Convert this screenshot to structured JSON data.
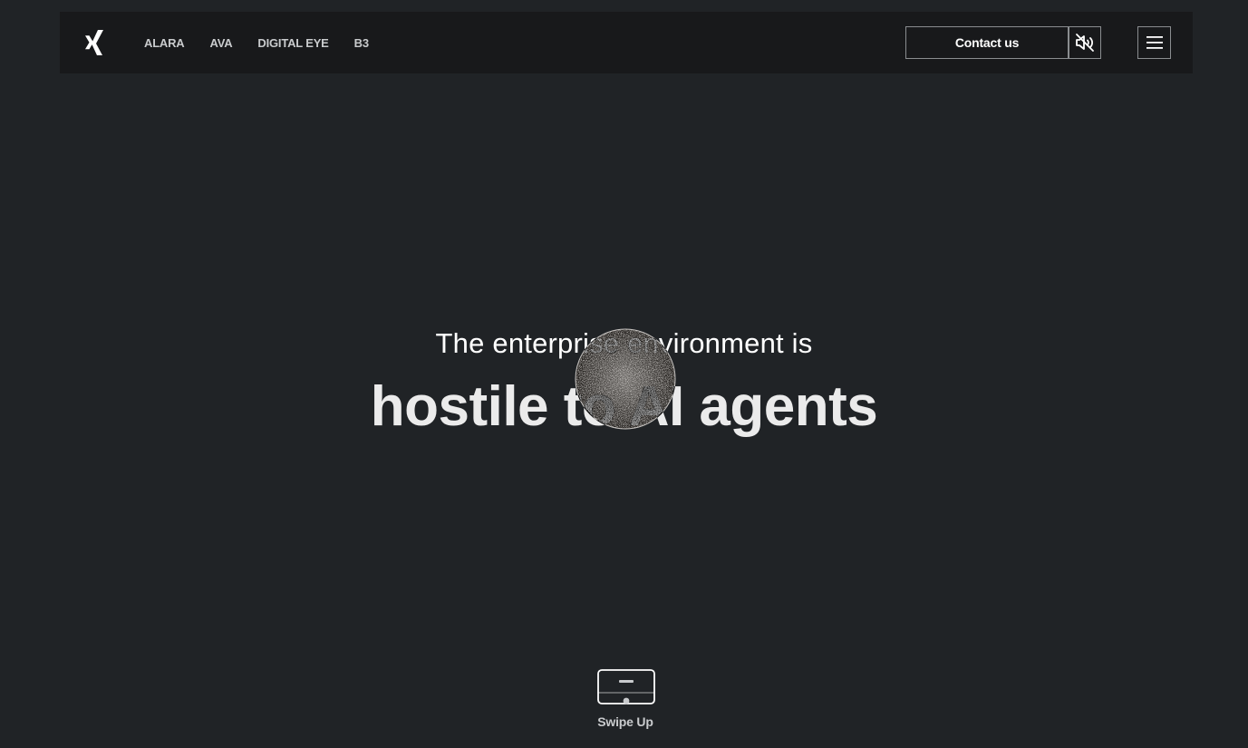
{
  "header": {
    "logo_icon": "x-brand-logo-icon",
    "nav": [
      {
        "label": "ALARA"
      },
      {
        "label": "AVA"
      },
      {
        "label": "DIGITAL EYE"
      },
      {
        "label": "B3"
      }
    ],
    "contact_label": "Contact us",
    "mute_icon": "speaker-muted-icon",
    "menu_icon": "hamburger-menu-icon"
  },
  "hero": {
    "subtitle": "The enterprise environment is",
    "title": "hostile to AI agents",
    "orb_icon": "noise-sphere-graphic"
  },
  "footer": {
    "swipe_icon": "swipe-up-device-icon",
    "swipe_label": "Swipe Up"
  },
  "colors": {
    "background": "#202326",
    "navbar": "#18191b",
    "text": "#ffffff",
    "muted_text": "#c9cbcd",
    "border": "#8a8d90"
  }
}
